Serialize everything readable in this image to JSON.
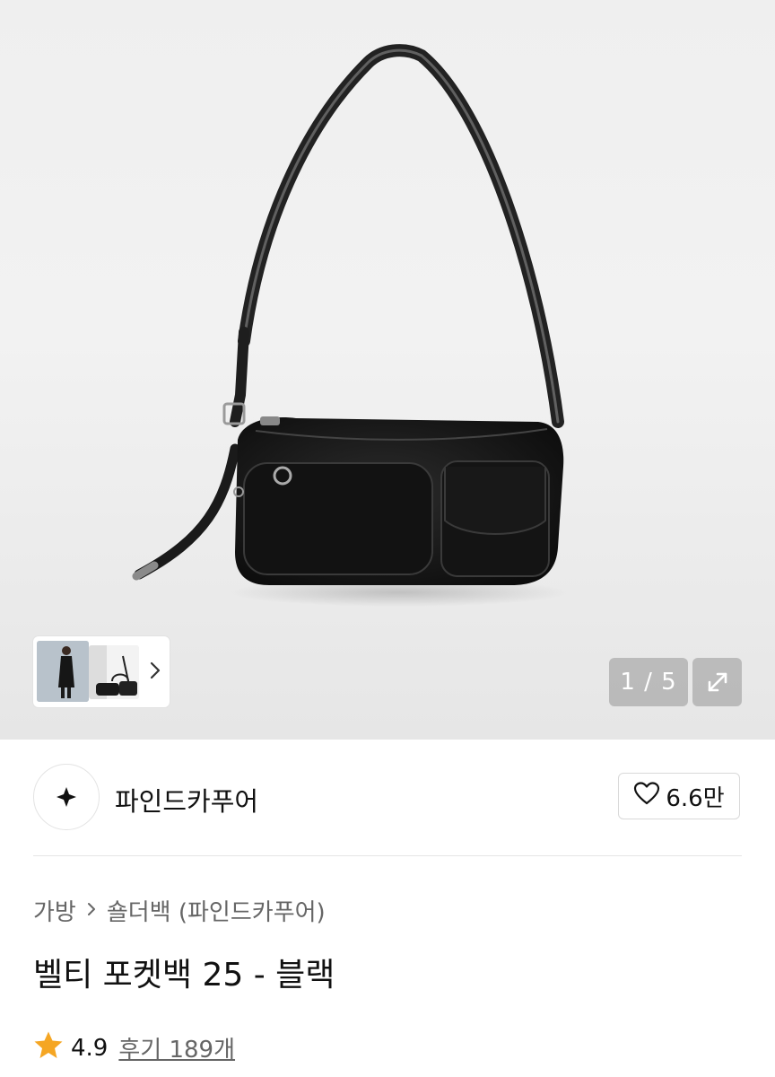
{
  "gallery": {
    "counter": "1 / 5",
    "current_index": 1,
    "total": 5,
    "expand_icon": "expand-icon",
    "thumbnail_next_icon": "chevron-right-icon"
  },
  "brand": {
    "name": "파인드카푸어",
    "logo_icon": "brand-logo-icon",
    "like_count": "6.6만",
    "like_icon": "heart-outline-icon"
  },
  "breadcrumb": {
    "items": [
      "가방",
      "숄더백 (파인드카푸어)"
    ],
    "separator_icon": "chevron-right-icon"
  },
  "product": {
    "title": "벨티 포켓백 25 - 블랙"
  },
  "rating": {
    "score": "4.9",
    "reviews_label": "후기 189개",
    "star_color": "#F5A623"
  }
}
